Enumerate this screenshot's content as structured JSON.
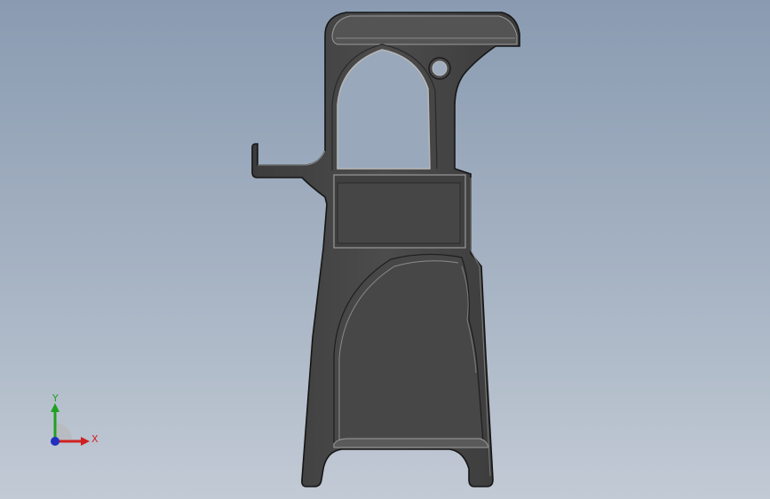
{
  "viewport": {
    "background_top": "#8a9bb1",
    "background_bottom": "#c2cad5"
  },
  "model": {
    "fill_color": "#4a4a4a",
    "edge_color": "#1a1a1a",
    "highlight_color": "#8c8c8c"
  },
  "triad": {
    "x_label": "X",
    "y_label": "Y",
    "x_color": "#d02020",
    "y_color": "#20a020",
    "z_color": "#2030c0"
  }
}
